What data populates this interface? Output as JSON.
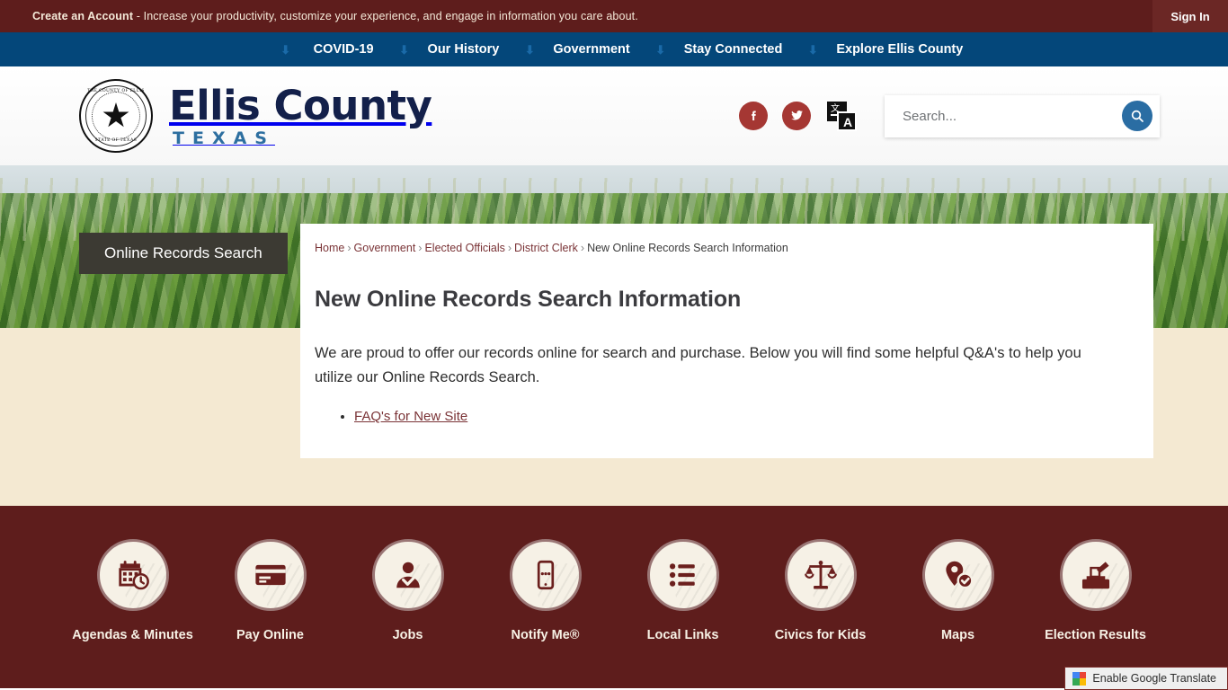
{
  "topbar": {
    "message_bold": "Create an Account",
    "message_rest": " - Increase your productivity, customize your experience, and engage in information you care about.",
    "signin_label": "Sign In"
  },
  "nav": {
    "items": [
      {
        "label": "COVID-19",
        "icon": "chevron-down-icon"
      },
      {
        "label": "Our History",
        "icon": "chevron-down-icon"
      },
      {
        "label": "Government",
        "icon": "chevron-down-icon"
      },
      {
        "label": "Stay Connected",
        "icon": "chevron-down-icon"
      },
      {
        "label": "Explore Ellis County",
        "icon": "chevron-down-icon"
      }
    ]
  },
  "header": {
    "seal_top_text": "THE COUNTY OF ELLIS",
    "seal_bottom_text": "STATE OF TEXAS",
    "wordmark_main": "Ellis County",
    "wordmark_sub": "TEXAS",
    "social": [
      {
        "name": "facebook-icon",
        "title": "Facebook"
      },
      {
        "name": "twitter-icon",
        "title": "Twitter"
      }
    ],
    "translate_icon": "translate-icon",
    "search": {
      "placeholder": "Search...",
      "value": "",
      "button_icon": "search-icon"
    }
  },
  "hero": {
    "image_description": "corn-field-banner",
    "page_tab_label": "Online Records Search"
  },
  "breadcrumb": {
    "items": [
      {
        "label": "Home",
        "link": true
      },
      {
        "label": "Government",
        "link": true
      },
      {
        "label": "Elected Officials",
        "link": true
      },
      {
        "label": "District Clerk",
        "link": true
      },
      {
        "label": "New Online Records Search Information",
        "link": false
      }
    ],
    "separator": "›"
  },
  "main": {
    "title": "New Online Records Search Information",
    "paragraph": "We are proud to offer our records online for search and purchase. Below you will find some helpful Q&A's to help you utilize our Online Records Search.",
    "links": [
      {
        "label": "FAQ's for New Site"
      }
    ]
  },
  "footer": {
    "quick_links": [
      {
        "label": "Agendas & Minutes",
        "icon": "calendar-clock-icon"
      },
      {
        "label": "Pay Online",
        "icon": "credit-card-icon"
      },
      {
        "label": "Jobs",
        "icon": "person-check-icon"
      },
      {
        "label": "Notify Me®",
        "icon": "mobile-phone-icon"
      },
      {
        "label": "Local Links",
        "icon": "bullet-list-icon"
      },
      {
        "label": "Civics for Kids",
        "icon": "scales-of-justice-icon"
      },
      {
        "label": "Maps",
        "icon": "map-pin-check-icon"
      },
      {
        "label": "Election Results",
        "icon": "ballot-box-icon"
      }
    ]
  },
  "google_translate": {
    "label": "Enable Google Translate",
    "icon": "google-logo-icon"
  },
  "colors": {
    "maroon": "#5e1d1c",
    "nav_blue": "#04477a",
    "beige": "#f4e9d2",
    "link_red": "#7a3336",
    "search_button_blue": "#2a6da3",
    "social_red": "#a53733",
    "wordmark_navy": "#13204a",
    "wordmark_sub_blue": "#2d6fa0"
  }
}
